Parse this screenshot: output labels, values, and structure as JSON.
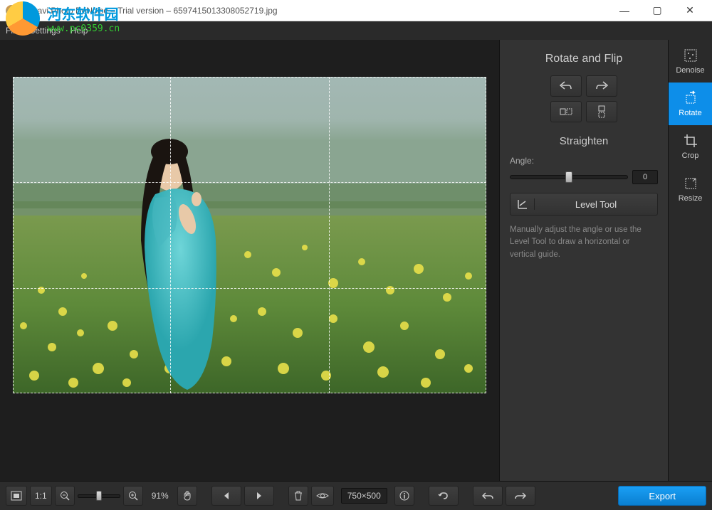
{
  "titlebar": {
    "app_name": "Movavi Photo DeNoise",
    "version_label": "Trial version",
    "filename": "659741501330805271​9.jpg"
  },
  "watermark": {
    "cn": "河东软件园",
    "url": "www.pc0359.cn"
  },
  "menubar": {
    "items": [
      "File",
      "Settings",
      "Help"
    ]
  },
  "panel": {
    "rotate_title": "Rotate and Flip",
    "straighten_title": "Straighten",
    "angle_label": "Angle:",
    "angle_value": "0",
    "level_label": "Level Tool",
    "help_text": "Manually adjust the angle or use the Level Tool to draw a horizontal or vertical guide."
  },
  "tools": [
    {
      "label": "Denoise"
    },
    {
      "label": "Rotate"
    },
    {
      "label": "Crop"
    },
    {
      "label": "Resize"
    }
  ],
  "bottombar": {
    "zoom_ratio": "1:1",
    "zoom_pct": "91%",
    "dims": "750×500",
    "export": "Export"
  }
}
